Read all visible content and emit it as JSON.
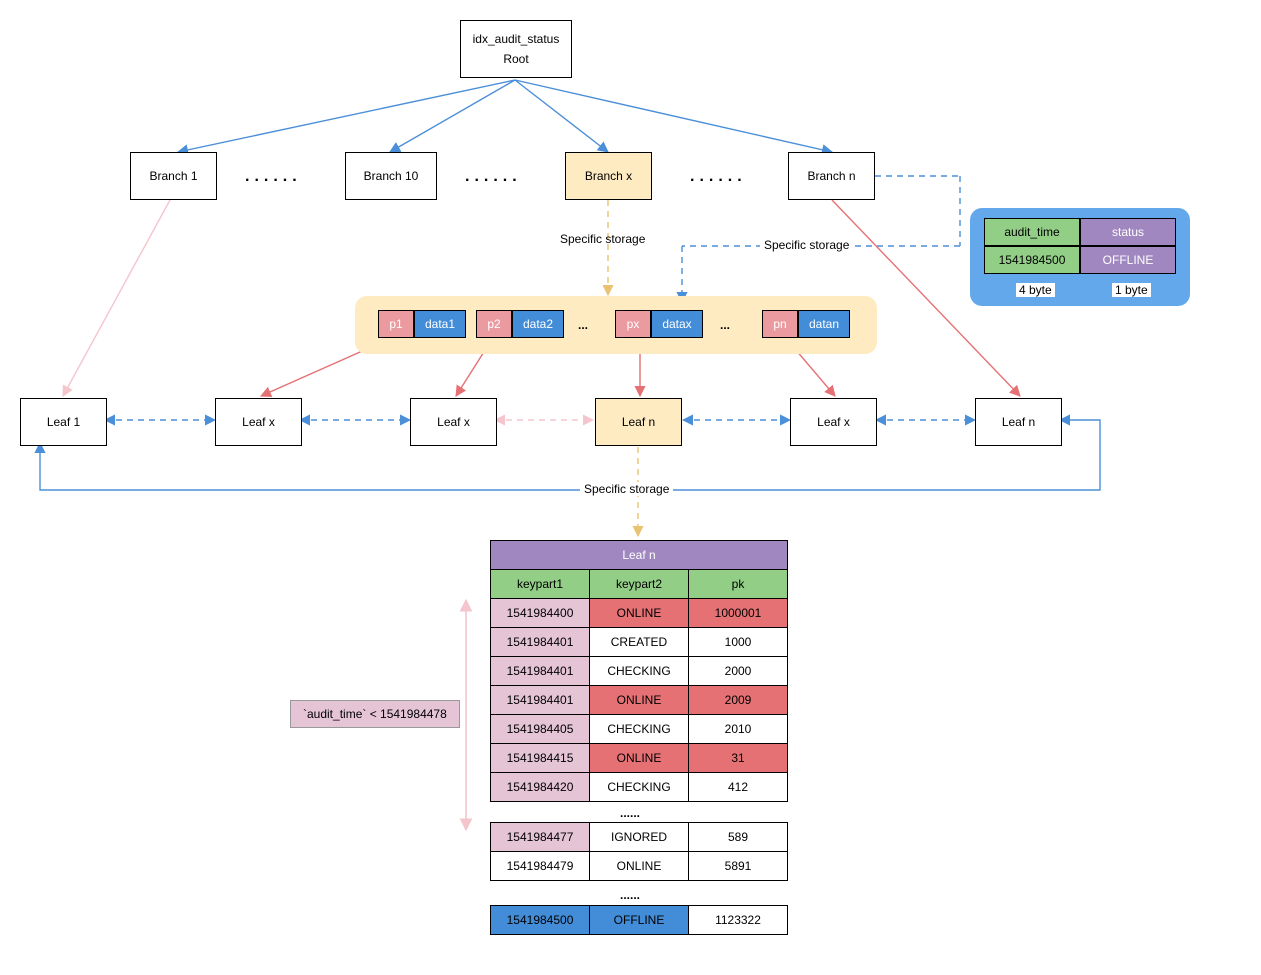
{
  "root": {
    "line1": "idx_audit_status",
    "line2": "Root"
  },
  "branches": {
    "b1": "Branch 1",
    "b10": "Branch 10",
    "bx": "Branch x",
    "bn": "Branch n"
  },
  "specific": "Specific storage",
  "storage": {
    "p1": "p1",
    "d1": "data1",
    "p2": "p2",
    "d2": "data2",
    "dot": "...",
    "px": "px",
    "dx": "datax",
    "pn": "pn",
    "dn": "datan"
  },
  "panel": {
    "h1": "audit_time",
    "h2": "status",
    "v1": "1541984500",
    "v2": "OFFLINE",
    "b4": "4 byte",
    "b1": "1 byte"
  },
  "leaves": {
    "l1": "Leaf 1",
    "lx": "Leaf x",
    "ln": "Leaf n"
  },
  "table": {
    "title": "Leaf n",
    "h1": "keypart1",
    "h2": "keypart2",
    "h3": "pk",
    "rows": [
      {
        "k1": "1541984400",
        "k2": "ONLINE",
        "pk": "1000001",
        "hl": "r"
      },
      {
        "k1": "1541984401",
        "k2": "CREATED",
        "pk": "1000"
      },
      {
        "k1": "1541984401",
        "k2": "CHECKING",
        "pk": "2000"
      },
      {
        "k1": "1541984401",
        "k2": "ONLINE",
        "pk": "2009",
        "hl": "r"
      },
      {
        "k1": "1541984405",
        "k2": "CHECKING",
        "pk": "2010"
      },
      {
        "k1": "1541984415",
        "k2": "ONLINE",
        "pk": "31",
        "hl": "r"
      },
      {
        "k1": "1541984420",
        "k2": "CHECKING",
        "pk": "412"
      }
    ],
    "dots": "......",
    "r8": {
      "k1": "1541984477",
      "k2": "IGNORED",
      "pk": "589"
    },
    "r9": {
      "k1": "1541984479",
      "k2": "ONLINE",
      "pk": "5891"
    },
    "r10": {
      "k1": "1541984500",
      "k2": "OFFLINE",
      "pk": "1123322"
    }
  },
  "condition": "`audit_time` < 1541984478",
  "dots": "......"
}
